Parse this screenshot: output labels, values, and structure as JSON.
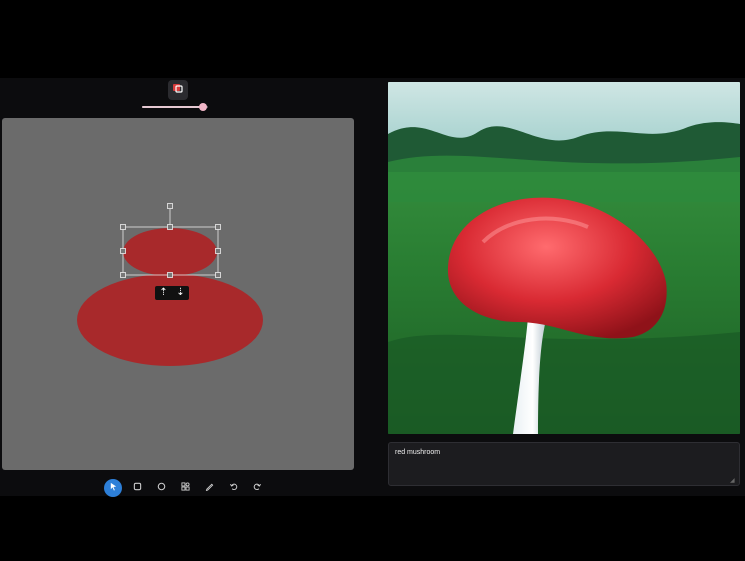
{
  "toolbar_top": {
    "layer_icon": "layers-icon",
    "size_slider": {
      "value": 0.93,
      "accent": "#f2b7c8"
    }
  },
  "canvas": {
    "background": "#6b6b6b",
    "shape_color": "#a8292b",
    "order_bar": {
      "bring_forward": "⇡",
      "send_backward": "⇣"
    }
  },
  "tools": [
    {
      "name": "select",
      "icon": "cursor-icon",
      "active": true
    },
    {
      "name": "rectangle",
      "icon": "square-icon",
      "active": false
    },
    {
      "name": "ellipse",
      "icon": "circle-icon",
      "active": false
    },
    {
      "name": "shapes",
      "icon": "shapes-icon",
      "active": false
    },
    {
      "name": "brush",
      "icon": "brush-icon",
      "active": false
    },
    {
      "name": "undo",
      "icon": "undo-icon",
      "active": false
    },
    {
      "name": "redo",
      "icon": "redo-icon",
      "active": false
    }
  ],
  "prompt": {
    "value": "red mushroom"
  },
  "colors": {
    "accent": "#2d7fd8",
    "panel": "#1c1c1f"
  }
}
